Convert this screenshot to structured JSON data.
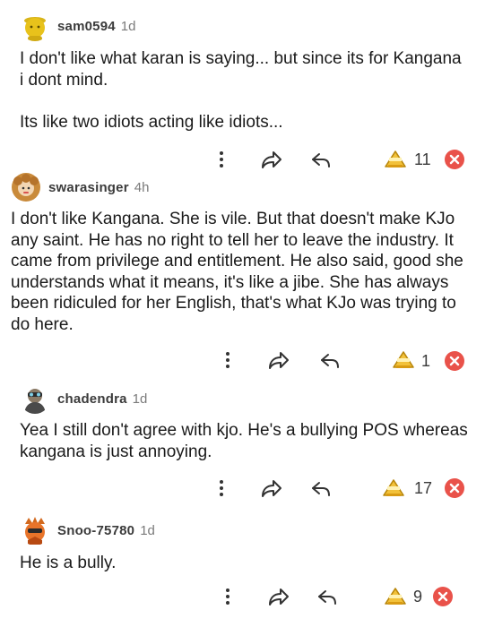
{
  "comments": [
    {
      "username": "sam0594",
      "time": "1d",
      "text": "I don't like what karan is saying... but since its for Kangana i dont mind.\n\nIts like two idiots acting like idiots...",
      "count": "11"
    },
    {
      "username": "swarasinger",
      "time": "4h",
      "text": "I don't like Kangana. She is vile. But that doesn't make KJo any saint. He has no right to tell her to leave the industry. It came from privilege and entitlement. He also said, good she understands what it means, it's like a jibe. She has always been ridiculed for her English, that's what KJo was trying to do here.",
      "count": "1"
    },
    {
      "username": "chadendra",
      "time": "1d",
      "text": "Yea I still don't agree with kjo. He's a bullying POS whereas kangana is just annoying.",
      "count": "17"
    },
    {
      "username": "Snoo-75780",
      "time": "1d",
      "text": "He is a bully.",
      "count": "9"
    }
  ],
  "icons": {
    "more": "kebab-icon",
    "share": "share-icon",
    "reply": "reply-icon",
    "award": "award-icon",
    "dismiss": "close-icon"
  },
  "colors": {
    "dismiss": "#e9524a",
    "award": "#f2c13a",
    "text": "#1a1a1a",
    "meta": "#7a7a7a"
  }
}
